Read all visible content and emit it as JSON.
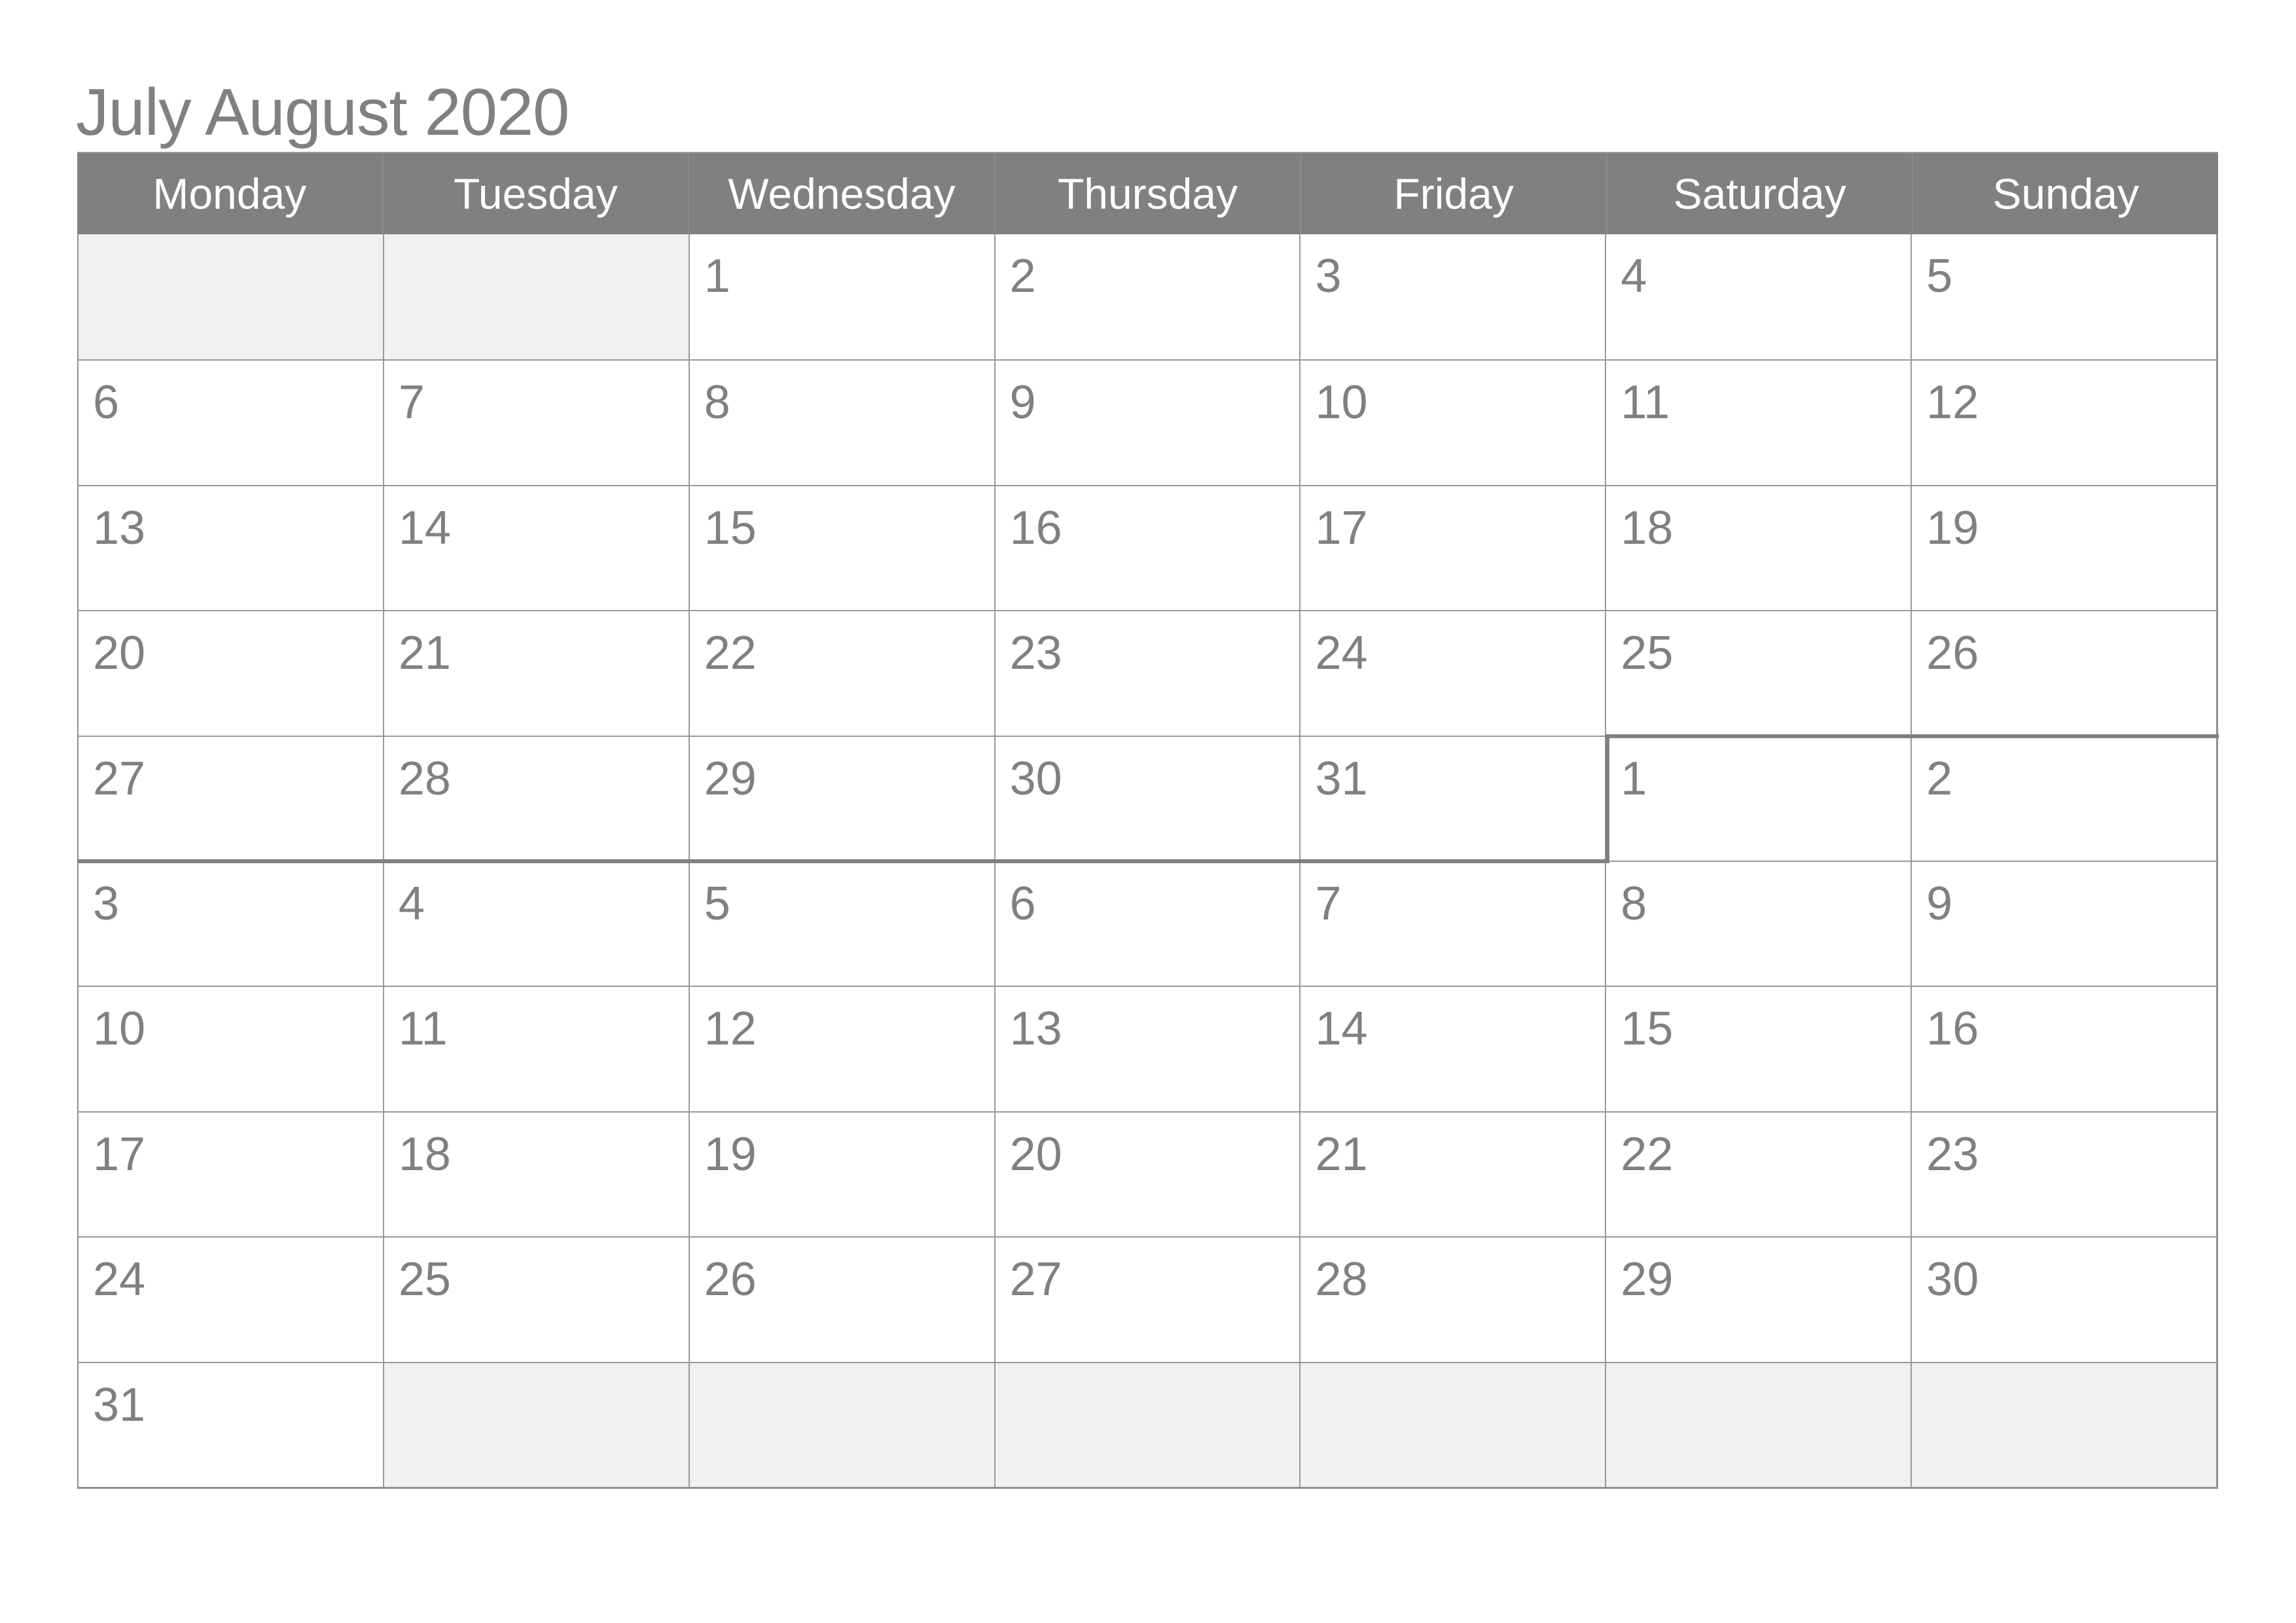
{
  "title": "July August 2020",
  "weekdays": [
    "Monday",
    "Tuesday",
    "Wednesday",
    "Thursday",
    "Friday",
    "Saturday",
    "Sunday"
  ],
  "colors": {
    "header_bg": "#808080",
    "header_text": "#ffffff",
    "text": "#808080",
    "empty_cell_bg": "#f1f1f1",
    "month_separator": "#808080"
  },
  "weeks": [
    [
      "",
      "",
      "1",
      "2",
      "3",
      "4",
      "5"
    ],
    [
      "6",
      "7",
      "8",
      "9",
      "10",
      "11",
      "12"
    ],
    [
      "13",
      "14",
      "15",
      "16",
      "17",
      "18",
      "19"
    ],
    [
      "20",
      "21",
      "22",
      "23",
      "24",
      "25",
      "26"
    ],
    [
      "27",
      "28",
      "29",
      "30",
      "31",
      "1",
      "2"
    ],
    [
      "3",
      "4",
      "5",
      "6",
      "7",
      "8",
      "9"
    ],
    [
      "10",
      "11",
      "12",
      "13",
      "14",
      "15",
      "16"
    ],
    [
      "17",
      "18",
      "19",
      "20",
      "21",
      "22",
      "23"
    ],
    [
      "24",
      "25",
      "26",
      "27",
      "28",
      "29",
      "30"
    ],
    [
      "31",
      "",
      "",
      "",
      "",
      "",
      ""
    ]
  ],
  "months": [
    {
      "name": "July",
      "first_day": "Wednesday",
      "last_date": "31"
    },
    {
      "name": "August",
      "first_day": "Saturday",
      "last_date": "31"
    }
  ]
}
